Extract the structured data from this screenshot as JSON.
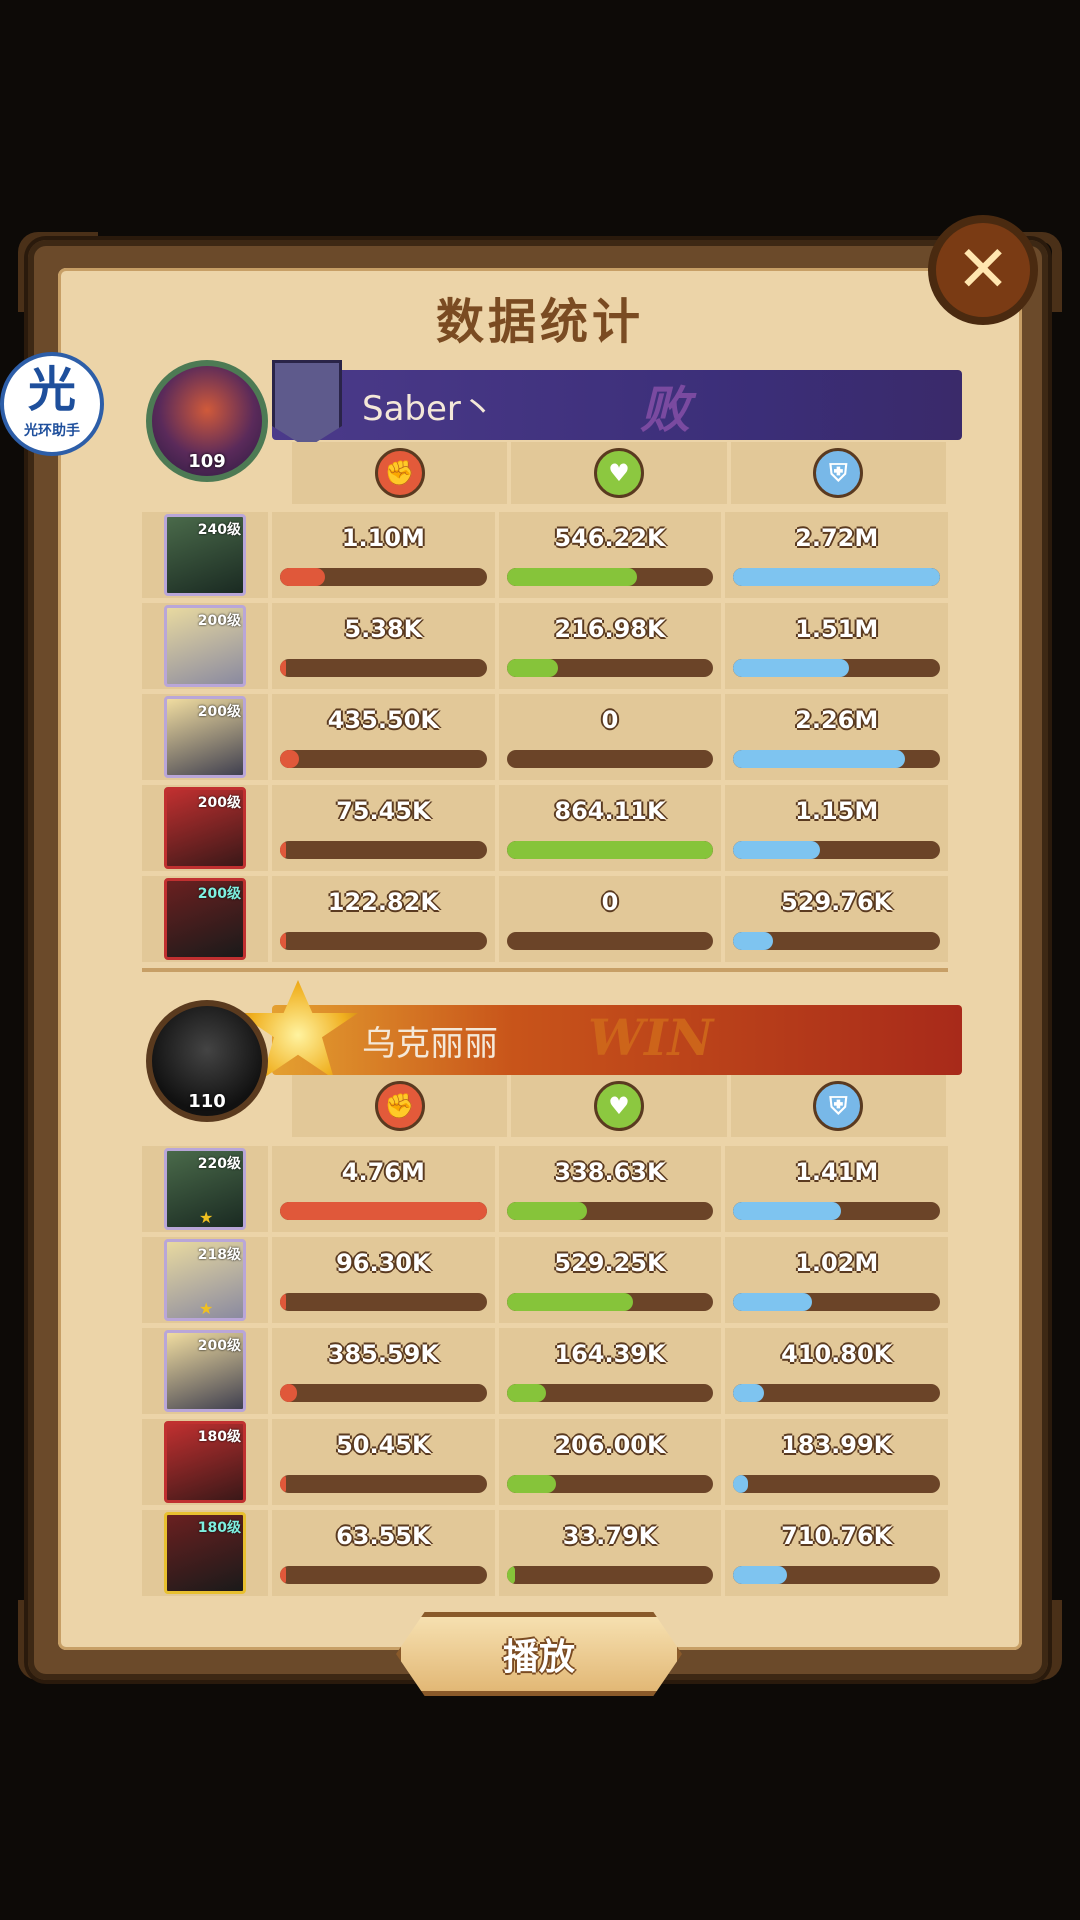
{
  "title": "数据统计",
  "close_label": "✕",
  "watermark": {
    "glyph": "光",
    "text": "光环助手"
  },
  "icons": [
    "attack-icon",
    "heal-icon",
    "shield-icon"
  ],
  "colors": {
    "attack": "#e0583a",
    "heal": "#86c43a",
    "defense": "#7ec4f0",
    "lose_banner": "#3b2e78",
    "win_banner": "#c8541a"
  },
  "teams": [
    {
      "player": "Saber丶",
      "avatar_level": "109",
      "result_text": "败",
      "heroes": [
        {
          "level": "240级",
          "dmg": "1.10M",
          "dmg_pct": 22,
          "heal": "546.22K",
          "heal_pct": 63,
          "def": "2.72M",
          "def_pct": 100
        },
        {
          "level": "200级",
          "dmg": "5.38K",
          "dmg_pct": 1,
          "heal": "216.98K",
          "heal_pct": 25,
          "def": "1.51M",
          "def_pct": 56
        },
        {
          "level": "200级",
          "dmg": "435.50K",
          "dmg_pct": 9,
          "heal": "0",
          "heal_pct": 0,
          "def": "2.26M",
          "def_pct": 83
        },
        {
          "level": "200级",
          "dmg": "75.45K",
          "dmg_pct": 2,
          "heal": "864.11K",
          "heal_pct": 100,
          "def": "1.15M",
          "def_pct": 42
        },
        {
          "level": "200级",
          "dmg": "122.82K",
          "dmg_pct": 3,
          "heal": "0",
          "heal_pct": 0,
          "def": "529.76K",
          "def_pct": 19
        }
      ]
    },
    {
      "player": "乌克丽丽",
      "avatar_level": "110",
      "result_text": "WIN",
      "heroes": [
        {
          "level": "220级",
          "dmg": "4.76M",
          "dmg_pct": 100,
          "heal": "338.63K",
          "heal_pct": 39,
          "def": "1.41M",
          "def_pct": 52
        },
        {
          "level": "218级",
          "dmg": "96.30K",
          "dmg_pct": 2,
          "heal": "529.25K",
          "heal_pct": 61,
          "def": "1.02M",
          "def_pct": 38
        },
        {
          "level": "200级",
          "dmg": "385.59K",
          "dmg_pct": 8,
          "heal": "164.39K",
          "heal_pct": 19,
          "def": "410.80K",
          "def_pct": 15
        },
        {
          "level": "180级",
          "dmg": "50.45K",
          "dmg_pct": 1,
          "heal": "206.00K",
          "heal_pct": 24,
          "def": "183.99K",
          "def_pct": 7
        },
        {
          "level": "180级",
          "dmg": "63.55K",
          "dmg_pct": 1,
          "heal": "33.79K",
          "heal_pct": 4,
          "def": "710.76K",
          "def_pct": 26
        }
      ]
    }
  ],
  "play_label": "播放"
}
